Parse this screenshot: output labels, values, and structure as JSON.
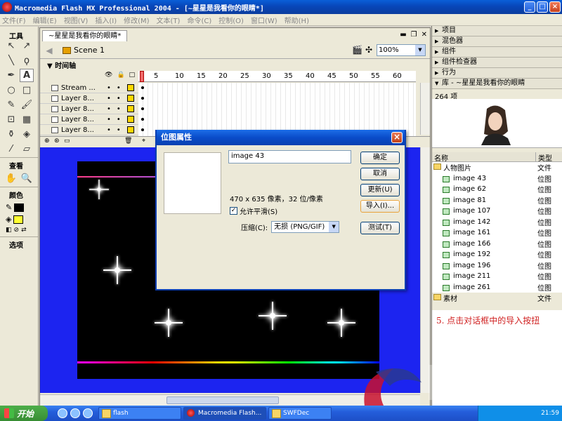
{
  "window": {
    "title": "Macromedia Flash MX Professional 2004 - [~星星是我看你的眼睛*]",
    "buttons": [
      "_",
      "□",
      "×"
    ]
  },
  "menu": [
    "文件(F)",
    "编辑(E)",
    "视图(V)",
    "插入(I)",
    "修改(M)",
    "文本(T)",
    "命令(C)",
    "控制(O)",
    "窗口(W)",
    "帮助(H)"
  ],
  "tools": {
    "header": "工具",
    "view_header": "查看",
    "color_header": "颜色",
    "options_header": "选项",
    "stroke_color": "#000000",
    "fill_color": "#ffff33"
  },
  "document": {
    "tab_title": "~星星是我看你的眼睛*",
    "scene": "Scene 1",
    "zoom": "100%",
    "timeline_label": "时间轴",
    "frame_numbers": [
      "1",
      "5",
      "10",
      "15",
      "20",
      "25",
      "30",
      "35",
      "40",
      "45",
      "50",
      "55",
      "60"
    ],
    "layers": [
      "Stream ...",
      "Layer 8...",
      "Layer 8...",
      "Layer 8...",
      "Layer 8..."
    ],
    "stage_color": "#000000",
    "workspace_color": "#1c24f0"
  },
  "panels": {
    "collapsed": [
      "项目",
      "混色器",
      "组件",
      "组件检查器",
      "行为"
    ],
    "library_title": "库 - ~星星是我看你的眼睛",
    "item_count": "264 项",
    "col_name": "名称",
    "col_kind": "类型",
    "folder_people": "人物图片",
    "folder_kind": "文件",
    "items": [
      "image 43",
      "image 62",
      "image 81",
      "image 107",
      "image 142",
      "image 161",
      "image 166",
      "image 192",
      "image 196",
      "image 211",
      "image 261"
    ],
    "item_kind": "位图",
    "folder_material": "素材",
    "note": "5. 点击对话框中的导入按扭"
  },
  "dialog": {
    "title": "位图属性",
    "name_value": "image 43",
    "info": "470 x 635 像素，32 位/像素",
    "smoothing_label": "允许平滑(S)",
    "compression_label": "压缩(C):",
    "compression_value": "无损 (PNG/GIF)",
    "btn_ok": "确定",
    "btn_cancel": "取消",
    "btn_update": "更新(U)",
    "btn_import": "导入(I)...",
    "btn_test": "测试(T)"
  },
  "taskbar": {
    "start": "开始",
    "tasks": [
      "flash",
      "Macromedia Flash...",
      "SWFDec"
    ],
    "clock": "21:59"
  }
}
